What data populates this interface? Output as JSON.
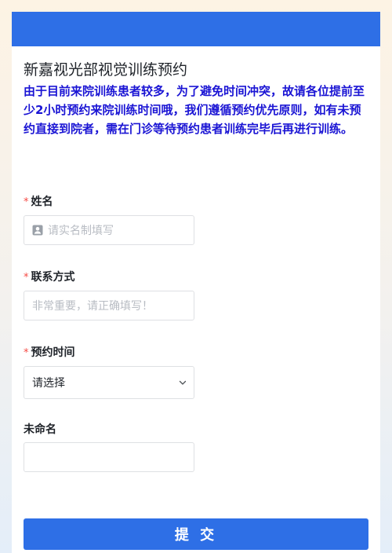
{
  "form": {
    "title": "新嘉视光部视觉训练预约",
    "description": "由于目前来院训练患者较多，为了避免时间冲突，故请各位提前至少2小时预约来院训练时间哦，我们遵循预约优先原则，如有未预约直接到院者，需在门诊等待预约患者训练完毕后再进行训练。"
  },
  "fields": {
    "name": {
      "required_mark": "*",
      "label": "姓名",
      "placeholder": "请实名制填写"
    },
    "contact": {
      "required_mark": "*",
      "label": "联系方式",
      "placeholder": "非常重要，请正确填写！"
    },
    "time": {
      "required_mark": "*",
      "label": "预约时间",
      "selected": "请选择"
    },
    "unnamed": {
      "label": "未命名",
      "value": ""
    }
  },
  "submit_label": "提 交",
  "colors": {
    "accent": "#2e6fe6",
    "description": "#1a14d4",
    "required": "#f54a45"
  }
}
